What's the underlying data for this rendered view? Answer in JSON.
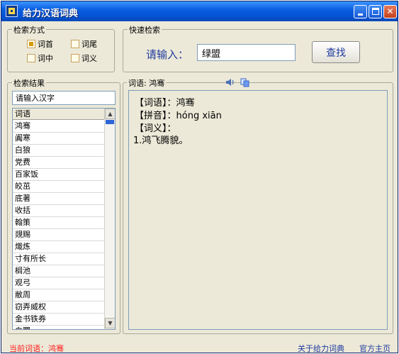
{
  "window": {
    "title": "给力汉语词典",
    "icon": "dictionary-app-icon"
  },
  "search_mode": {
    "legend": "检索方式",
    "options": [
      {
        "label": "词首",
        "checked": true
      },
      {
        "label": "词尾",
        "checked": false
      },
      {
        "label": "词中",
        "checked": false
      },
      {
        "label": "词义",
        "checked": false
      }
    ]
  },
  "quick_search": {
    "legend": "快速检索",
    "prompt": "请输入：",
    "value": "绿盟",
    "button_label": "查找"
  },
  "results": {
    "legend": "检索结果",
    "input_value": "请输入汉字",
    "column_header": "词语",
    "items": [
      "鸿骞",
      "阗寒",
      "白狼",
      "党费",
      "百家饭",
      "皎茁",
      "底著",
      "收括",
      "翰策",
      "覢赐",
      "熾炼",
      "寸有所长",
      "榈池",
      "观弓",
      "敝周",
      "窃弄威权",
      "金书铁券",
      "白罪"
    ]
  },
  "detail": {
    "title": "词语: 鸿骞",
    "word_label": "【词语】：",
    "word": "鸿骞",
    "pinyin_label": "【拼音】：",
    "pinyin": "hóng xiān",
    "meaning_label": "【词义】：",
    "meaning": "1.鸿飞腾貌。"
  },
  "status": {
    "current_word_label": "当前词语：",
    "current_word": "鸿骞",
    "about_link": "关于给力词典",
    "home_link": "官方主页"
  },
  "colors": {
    "titlebar": "#0554d6",
    "accent_text": "#1f3a9e",
    "status_red": "#ff2020",
    "checkbox_fill": "#d29a10"
  }
}
